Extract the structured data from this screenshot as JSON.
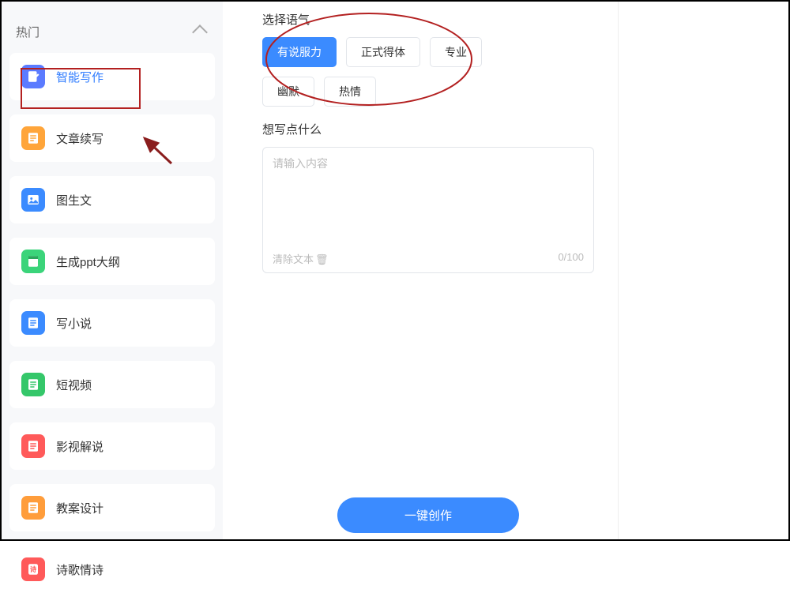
{
  "sidebar": {
    "section_title": "热门",
    "items": [
      {
        "label": "智能写作"
      },
      {
        "label": "文章续写"
      },
      {
        "label": "图生文"
      },
      {
        "label": "生成ppt大纲"
      },
      {
        "label": "写小说"
      },
      {
        "label": "短视频"
      },
      {
        "label": "影视解说"
      },
      {
        "label": "教案设计"
      },
      {
        "label": "诗歌情诗"
      }
    ]
  },
  "main": {
    "tone_label": "选择语气",
    "tones": [
      {
        "label": "有说服力"
      },
      {
        "label": "正式得体"
      },
      {
        "label": "专业"
      },
      {
        "label": "幽默"
      },
      {
        "label": "热情"
      }
    ],
    "content_label": "想写点什么",
    "content_placeholder": "请输入内容",
    "clear_text": "清除文本",
    "char_count": "0/100",
    "submit_label": "一键创作"
  }
}
